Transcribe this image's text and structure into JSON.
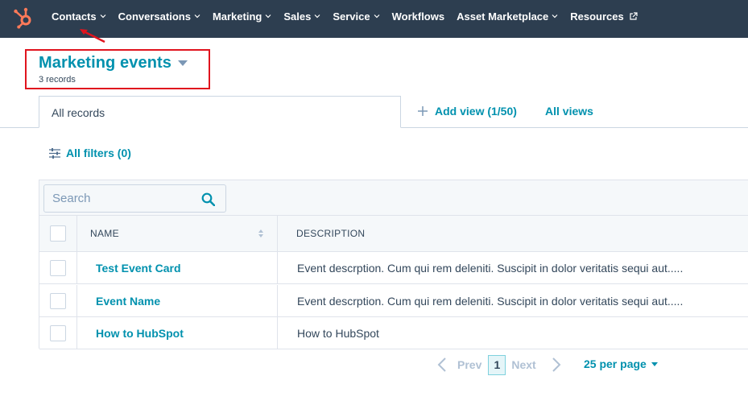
{
  "nav": {
    "logo_icon": "hubspot-sprocket-icon",
    "items": [
      {
        "label": "Contacts",
        "dropdown": true
      },
      {
        "label": "Conversations",
        "dropdown": true
      },
      {
        "label": "Marketing",
        "dropdown": true
      },
      {
        "label": "Sales",
        "dropdown": true
      },
      {
        "label": "Service",
        "dropdown": true
      },
      {
        "label": "Workflows",
        "dropdown": false
      },
      {
        "label": "Asset Marketplace",
        "dropdown": true
      },
      {
        "label": "Resources",
        "external": true
      }
    ]
  },
  "header": {
    "title": "Marketing events",
    "count": "3 records"
  },
  "tabs": {
    "active": "All records",
    "add_view": "Add view (1/50)",
    "all_views": "All views"
  },
  "filters": {
    "label": "All filters (0)"
  },
  "search": {
    "placeholder": "Search",
    "value": ""
  },
  "table": {
    "columns": [
      "NAME",
      "DESCRIPTION"
    ],
    "rows": [
      {
        "name": "Test Event Card",
        "description": "Event descrption. Cum qui rem deleniti. Suscipit in dolor veritatis sequi aut....."
      },
      {
        "name": "Event Name",
        "description": "Event descrption. Cum qui rem deleniti. Suscipit in dolor veritatis sequi aut....."
      },
      {
        "name": "How to HubSpot",
        "description": "How to HubSpot"
      }
    ]
  },
  "pagination": {
    "prev": "Prev",
    "page": "1",
    "next": "Next",
    "per_page": "25 per page"
  },
  "colors": {
    "nav_bg": "#2d3e50",
    "accent": "#0091ae",
    "logo": "#ff7a59",
    "highlight_box": "#e0141e"
  }
}
